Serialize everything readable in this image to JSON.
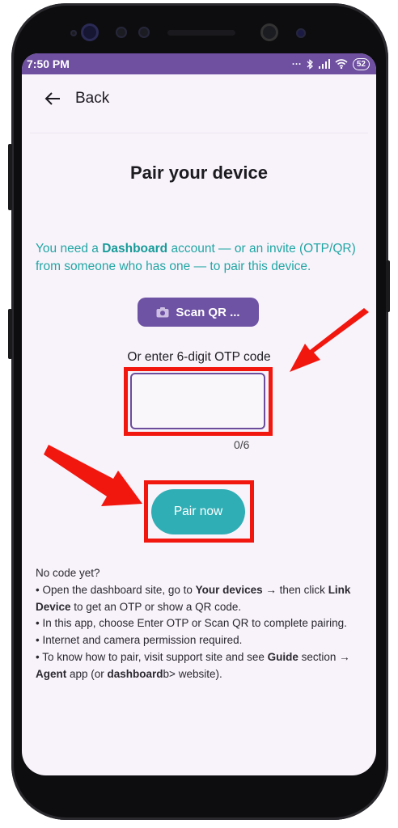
{
  "status": {
    "time": "7:50 PM",
    "battery": "52"
  },
  "nav": {
    "back_label": "Back"
  },
  "page": {
    "title": "Pair your device",
    "info_pre": "You need a ",
    "info_bold": "Dashboard",
    "info_post": " account — or an invite (OTP/QR) from someone who has one — to pair this device.",
    "scan_label": "Scan QR ...",
    "otp_label": "Or enter 6-digit OTP code",
    "otp_value": "",
    "otp_counter": "0/6",
    "pair_label": "Pair now"
  },
  "help": {
    "heading": "No code yet?",
    "l1_a": "• Open the dashboard site, go to ",
    "l1_b": "Your devices",
    "l1_c": " → then click ",
    "l1_d": "Link Device",
    "l1_e": " to get an OTP or show a QR code.",
    "l2": "• In this app, choose Enter OTP or Scan QR to complete pairing.",
    "l3": "• Internet and camera permission required.",
    "l4_a": "• To know how to pair, visit support site and see ",
    "l4_b": "Guide",
    "l4_c": " section → ",
    "l4_d": "Agent",
    "l4_e": " app (or ",
    "l4_f": "dashboard",
    "l4_g": "b> website)."
  },
  "colors": {
    "statusbar": "#6e4fa0",
    "accent_teal": "#21a6a3",
    "scan_button": "#6e52a3",
    "pair_button": "#30aeb5",
    "highlight_red": "#f1170f"
  }
}
